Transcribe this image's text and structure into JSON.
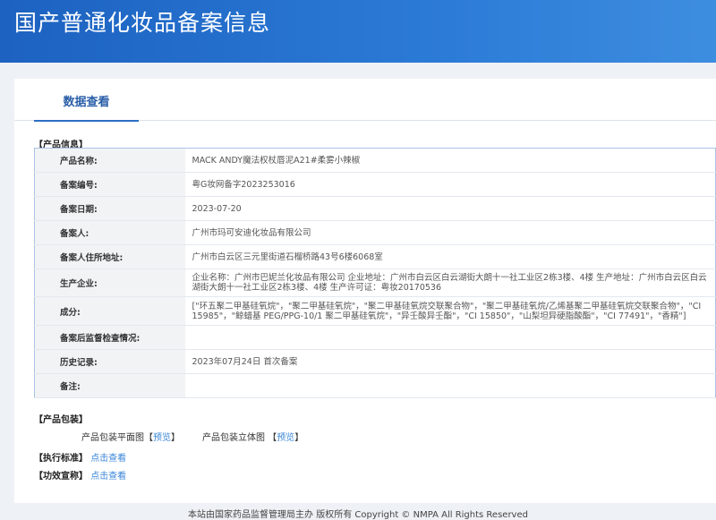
{
  "header": {
    "title": "国产普通化妆品备案信息"
  },
  "tab": "数据查看",
  "section_product": "【产品信息】",
  "rows": [
    {
      "label": "产品名称:",
      "value": "MACK ANDY魔法权杖唇泥A21#柔雾小辣椒"
    },
    {
      "label": "备案编号:",
      "value": "粤G妆网备字2023253016"
    },
    {
      "label": "备案日期:",
      "value": "2023-07-20"
    },
    {
      "label": "备案人:",
      "value": "广州市玛可安迪化妆品有限公司"
    },
    {
      "label": "备案人住所地址:",
      "value": "广州市白云区三元里街道石榴桥路43号6楼6068室"
    },
    {
      "label": "生产企业:",
      "value": "企业名称：广州市巴妮兰化妆品有限公司 企业地址：广州市白云区白云湖街大朗十一社工业区2栋3楼、4楼 生产地址：广州市白云区白云湖街大朗十一社工业区2栋3楼、4楼 生产许可证：粤妆20170536"
    },
    {
      "label": "成分:",
      "value": "[\"环五聚二甲基硅氧烷\"，\"聚二甲基硅氧烷\"，\"聚二甲基硅氧烷交联聚合物\"，\"聚二甲基硅氧烷/乙烯基聚二甲基硅氧烷交联聚合物\"，\"CI 15985\"，\"鲸蜡基 PEG/PPG-10/1 聚二甲基硅氧烷\"，\"异壬酸异壬酯\"，\"CI 15850\"，\"山梨坦异硬脂酸酯\"，\"CI 77491\"，\"香精\"]"
    },
    {
      "label": "备案后监督检查情况:",
      "value": ""
    },
    {
      "label": "历史记录:",
      "value": "2023年07月24日 首次备案"
    },
    {
      "label": "备注:",
      "value": ""
    }
  ],
  "packaging": {
    "title": "【产品包装】",
    "flat_label": "产品包装平面图【",
    "solid_label": "产品包装立体图 【",
    "preview": "预览",
    "close": "】"
  },
  "standard": {
    "label": "【执行标准】",
    "link": "点击查看"
  },
  "efficacy": {
    "label": "【功效宣称】",
    "link": "点击查看"
  },
  "footer": "本站由国家药品监督管理局主办 版权所有 Copyright © NMPA All Rights Reserved"
}
